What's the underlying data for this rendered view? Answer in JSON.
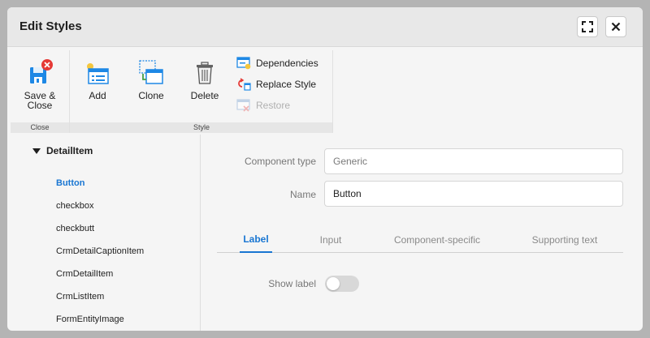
{
  "dialog": {
    "title": "Edit Styles",
    "maximize_icon": "expand-icon",
    "close_icon": "close-icon"
  },
  "ribbon": {
    "groups": [
      {
        "label": "Close"
      },
      {
        "label": "Style"
      }
    ],
    "buttons": {
      "save_close": {
        "label": "Save & Close",
        "icon": "save-close-icon"
      },
      "add": {
        "label": "Add",
        "icon": "add-style-icon"
      },
      "clone": {
        "label": "Clone",
        "icon": "clone-icon"
      },
      "delete": {
        "label": "Delete",
        "icon": "trash-icon"
      },
      "dependencies": {
        "label": "Dependencies",
        "icon": "dependencies-icon"
      },
      "replace_style": {
        "label": "Replace Style",
        "icon": "replace-style-icon"
      },
      "restore": {
        "label": "Restore",
        "icon": "restore-icon",
        "disabled": true
      }
    }
  },
  "tree": {
    "root": "DetailItem",
    "items": [
      "Button",
      "checkbox",
      "checkbutt",
      "CrmDetailCaptionItem",
      "CrmDetailItem",
      "CrmListItem",
      "FormEntityImage"
    ],
    "selected": "Button"
  },
  "form": {
    "component_type": {
      "label": "Component type",
      "value": "Generic"
    },
    "name": {
      "label": "Name",
      "value": "Button"
    }
  },
  "tabs": [
    {
      "label": "Label",
      "active": true
    },
    {
      "label": "Input",
      "active": false
    },
    {
      "label": "Component-specific",
      "active": false
    },
    {
      "label": "Supporting text",
      "active": false
    }
  ],
  "label_tab": {
    "show_label": {
      "label": "Show label",
      "checked": false
    }
  },
  "colors": {
    "accent": "#1976d2",
    "danger": "#e53935"
  }
}
